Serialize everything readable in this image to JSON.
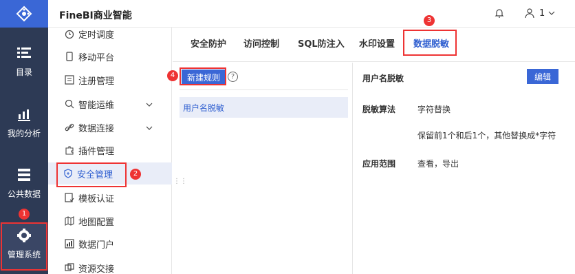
{
  "header": {
    "title": "FineBI商业智能",
    "user_label": "1"
  },
  "leftnav": {
    "items": [
      {
        "label": "目录",
        "icon": "catalog-icon"
      },
      {
        "label": "我的分析",
        "icon": "analysis-icon"
      },
      {
        "label": "公共数据",
        "icon": "data-icon"
      },
      {
        "label": "管理系统",
        "icon": "gear-icon"
      }
    ]
  },
  "sidebar": {
    "items": [
      {
        "label": "定时调度",
        "icon": "clock-icon"
      },
      {
        "label": "移动平台",
        "icon": "mobile-icon"
      },
      {
        "label": "注册管理",
        "icon": "register-icon"
      },
      {
        "label": "智能运维",
        "icon": "ops-icon"
      },
      {
        "label": "数据连接",
        "icon": "link-icon"
      },
      {
        "label": "插件管理",
        "icon": "plugin-icon"
      },
      {
        "label": "安全管理",
        "icon": "shield-icon"
      },
      {
        "label": "模板认证",
        "icon": "template-icon"
      },
      {
        "label": "地图配置",
        "icon": "map-icon"
      },
      {
        "label": "数据门户",
        "icon": "portal-icon"
      },
      {
        "label": "资源交接",
        "icon": "resource-icon"
      }
    ]
  },
  "tabs": [
    "安全防护",
    "访问控制",
    "SQL防注入",
    "水印设置",
    "数据脱敏"
  ],
  "left_panel": {
    "new_rule_label": "新建规则",
    "help_symbol": "?",
    "rules": [
      "用户名脱敏"
    ]
  },
  "right_panel": {
    "title": "用户名脱敏",
    "edit_label": "编辑",
    "algorithm_label": "脱敏算法",
    "algorithm_value": "字符替换",
    "algorithm_detail": "保留前1个和后1个，其他替换成*字符",
    "scope_label": "应用范围",
    "scope_value": "查看，导出"
  },
  "annotations": [
    "1",
    "2",
    "3",
    "4"
  ],
  "colors": {
    "nav_bg": "#2d3a55",
    "accent": "#3a67d6",
    "annotation": "#e33333",
    "selected_bg": "#e9edf8"
  }
}
